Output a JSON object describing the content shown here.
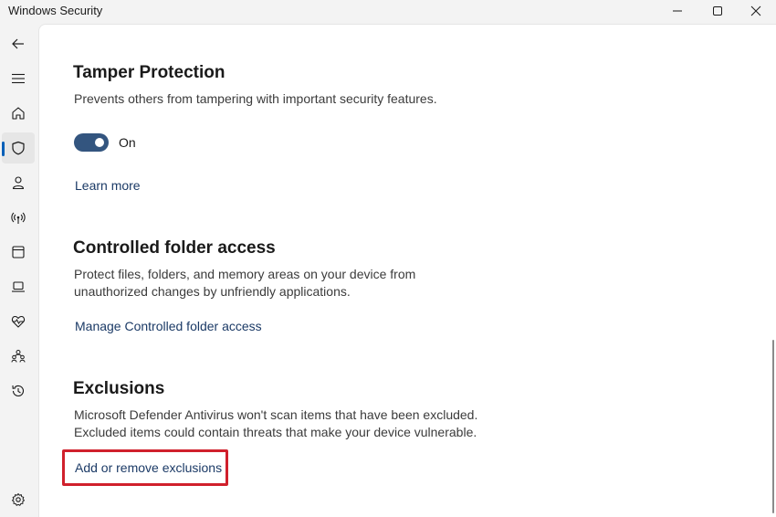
{
  "window": {
    "title": "Windows Security"
  },
  "sidebar": {
    "items": [
      {
        "icon": "back-arrow-icon"
      },
      {
        "icon": "hamburger-menu-icon"
      },
      {
        "icon": "home-icon"
      },
      {
        "icon": "shield-icon",
        "selected": true
      },
      {
        "icon": "person-icon"
      },
      {
        "icon": "wireless-icon"
      },
      {
        "icon": "app-browser-icon"
      },
      {
        "icon": "laptop-icon"
      },
      {
        "icon": "heart-pulse-icon"
      },
      {
        "icon": "family-icon"
      },
      {
        "icon": "history-icon"
      },
      {
        "icon": "gear-icon"
      }
    ]
  },
  "tamper": {
    "title": "Tamper Protection",
    "description": "Prevents others from tampering with important security features.",
    "toggle_state": "On",
    "toggle_on": true,
    "learn_more": "Learn more"
  },
  "cfa": {
    "title": "Controlled folder access",
    "description_line1": "Protect files, folders, and memory areas on your device from",
    "description_line2": "unauthorized changes by unfriendly applications.",
    "manage_link": "Manage Controlled folder access"
  },
  "exclusions": {
    "title": "Exclusions",
    "description_line1": "Microsoft Defender Antivirus won't scan items that have been excluded.",
    "description_line2": "Excluded items could contain threats that make your device vulnerable.",
    "add_remove_link": "Add or remove exclusions"
  },
  "colors": {
    "accent": "#33557f",
    "link": "#1b3a66",
    "highlight": "#d0202c"
  }
}
